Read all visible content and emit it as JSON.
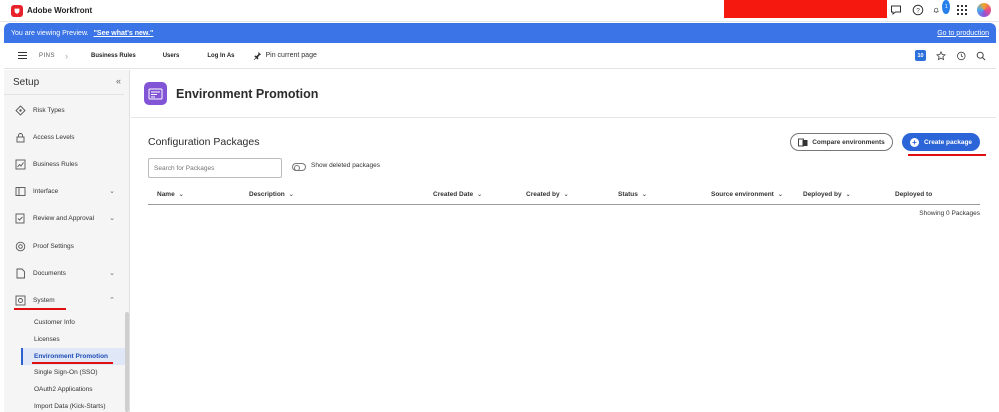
{
  "app": {
    "name": "Adobe Workfront",
    "notification_count": "1"
  },
  "preview_banner": {
    "message": "You are viewing Preview.",
    "link": "\"See what's new.\"",
    "goto": "Go to production"
  },
  "navbar": {
    "pins": "PINS",
    "items": [
      "Business Rules",
      "Users",
      "Log In As"
    ],
    "pin_page": "Pin current page",
    "recent_count": "10"
  },
  "sidebar": {
    "title": "Setup",
    "items": [
      {
        "label": "Risk Types",
        "icon": "risk-types-icon"
      },
      {
        "label": "Access Levels",
        "icon": "lock-icon"
      },
      {
        "label": "Business Rules",
        "icon": "business-rules-icon"
      },
      {
        "label": "Interface",
        "icon": "interface-icon",
        "expandable": true
      },
      {
        "label": "Review and Approval",
        "icon": "review-approval-icon",
        "expandable": true
      },
      {
        "label": "Proof Settings",
        "icon": "proof-settings-icon"
      },
      {
        "label": "Documents",
        "icon": "document-icon",
        "expandable": true
      },
      {
        "label": "System",
        "icon": "system-icon",
        "expanded": true
      }
    ],
    "subitems": [
      "Customer Info",
      "Licenses",
      "Environment Promotion",
      "Single Sign-On (SSO)",
      "OAuth2 Applications",
      "Import Data (Kick-Starts)"
    ],
    "active_subitem": "Environment Promotion"
  },
  "page": {
    "title": "Environment Promotion"
  },
  "packages": {
    "section_title": "Configuration Packages",
    "compare_button": "Compare environments",
    "create_button": "Create package",
    "search_placeholder": "Search for Packages",
    "show_deleted": "Show deleted packages",
    "columns": [
      "Name",
      "Description",
      "Created Date",
      "Created by",
      "Status",
      "Source environment",
      "Deployed by",
      "Deployed to"
    ],
    "showing": "Showing 0 Packages"
  },
  "colors": {
    "accent": "#2c65d7",
    "preview_banner": "#3b74e6",
    "page_icon": "#8254d6",
    "annotation_red": "#e01010"
  }
}
